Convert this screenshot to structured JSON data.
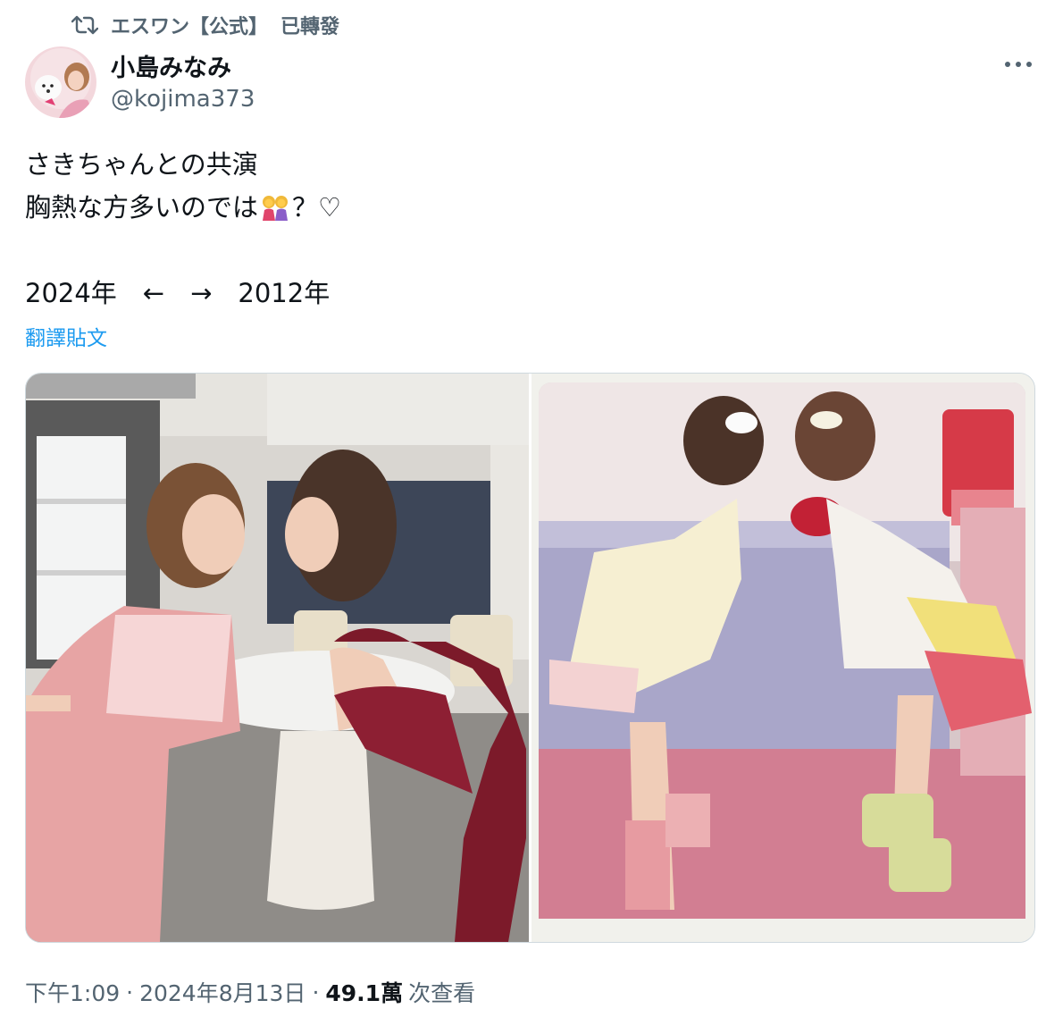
{
  "repost": {
    "account": "エスワン【公式】",
    "action": "已轉發",
    "icon": "repost-icon"
  },
  "author": {
    "display_name": "小島みなみ",
    "handle": "@kojima373"
  },
  "tweet": {
    "line1": "さきちゃんとの共演",
    "line2_text": "胸熱な方多いのでは",
    "line2_emoji": "two-women-emoji",
    "line2_tail": "？♡",
    "line3": "2024年　←　→　2012年"
  },
  "translate_label": "翻譯貼文",
  "media": [
    {
      "name": "photo-2024",
      "description_icon": "photo"
    },
    {
      "name": "photo-2012",
      "description_icon": "photo"
    }
  ],
  "meta": {
    "time": "下午1:09",
    "date": "2024年8月13日",
    "views_count": "49.1萬",
    "views_label": "次查看",
    "separator": "·"
  },
  "colors": {
    "text_primary": "#0f1419",
    "text_secondary": "#536471",
    "link": "#1d9bf0",
    "border": "#cfd9de"
  }
}
